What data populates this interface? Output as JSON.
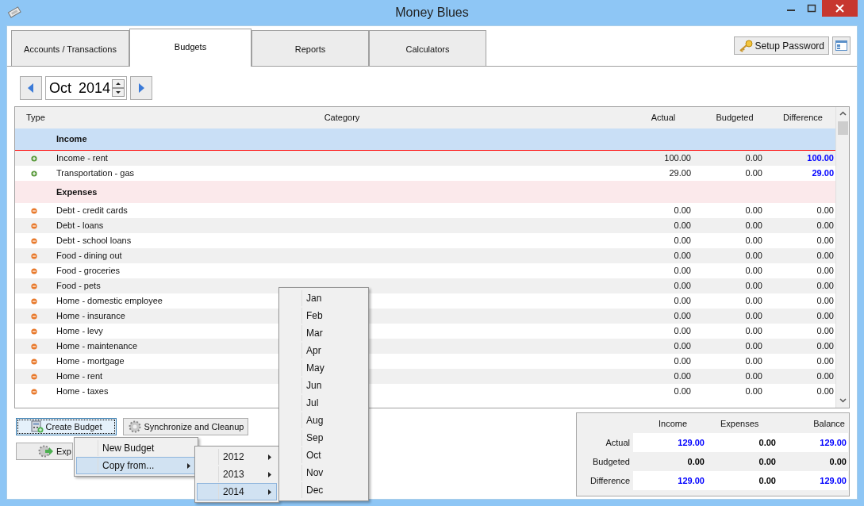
{
  "window": {
    "title": "Money Blues"
  },
  "tabs": [
    {
      "label": "Accounts / Transactions",
      "selected": false
    },
    {
      "label": "Budgets",
      "selected": true
    },
    {
      "label": "Reports",
      "selected": false
    },
    {
      "label": "Calculators",
      "selected": false
    }
  ],
  "setup_password": "Setup Password",
  "period": {
    "value": "Oct 2014"
  },
  "table": {
    "columns": [
      "Type",
      "Category",
      "Actual",
      "Budgeted",
      "Difference"
    ],
    "groups": [
      {
        "name": "Income",
        "kind": "income",
        "rows": [
          {
            "category": "Income - rent",
            "actual": "100.00",
            "budgeted": "0.00",
            "difference": "100.00",
            "highlighted": true
          },
          {
            "category": "Transportation - gas",
            "actual": "29.00",
            "budgeted": "0.00",
            "difference": "29.00",
            "highlighted": true
          }
        ]
      },
      {
        "name": "Expenses",
        "kind": "expense",
        "rows": [
          {
            "category": "Debt - credit cards",
            "actual": "0.00",
            "budgeted": "0.00",
            "difference": "0.00",
            "highlighted": false
          },
          {
            "category": "Debt - loans",
            "actual": "0.00",
            "budgeted": "0.00",
            "difference": "0.00",
            "highlighted": false
          },
          {
            "category": "Debt - school loans",
            "actual": "0.00",
            "budgeted": "0.00",
            "difference": "0.00",
            "highlighted": false
          },
          {
            "category": "Food - dining out",
            "actual": "0.00",
            "budgeted": "0.00",
            "difference": "0.00",
            "highlighted": false
          },
          {
            "category": "Food - groceries",
            "actual": "0.00",
            "budgeted": "0.00",
            "difference": "0.00",
            "highlighted": false
          },
          {
            "category": "Food - pets",
            "actual": "0.00",
            "budgeted": "0.00",
            "difference": "0.00",
            "highlighted": false
          },
          {
            "category": "Home - domestic employee",
            "actual": "0.00",
            "budgeted": "0.00",
            "difference": "0.00",
            "highlighted": false
          },
          {
            "category": "Home - insurance",
            "actual": "0.00",
            "budgeted": "0.00",
            "difference": "0.00",
            "highlighted": false
          },
          {
            "category": "Home - levy",
            "actual": "0.00",
            "budgeted": "0.00",
            "difference": "0.00",
            "highlighted": false
          },
          {
            "category": "Home - maintenance",
            "actual": "0.00",
            "budgeted": "0.00",
            "difference": "0.00",
            "highlighted": false
          },
          {
            "category": "Home - mortgage",
            "actual": "0.00",
            "budgeted": "0.00",
            "difference": "0.00",
            "highlighted": false
          },
          {
            "category": "Home - rent",
            "actual": "0.00",
            "budgeted": "0.00",
            "difference": "0.00",
            "highlighted": false
          },
          {
            "category": "Home - taxes",
            "actual": "0.00",
            "budgeted": "0.00",
            "difference": "0.00",
            "highlighted": false
          }
        ]
      }
    ]
  },
  "buttons": [
    {
      "label": "Create Budget",
      "kind": "create",
      "focused": true
    },
    {
      "label": "Synchronize and Cleanup",
      "kind": "sync",
      "focused": false
    },
    {
      "label": "Exp",
      "kind": "export",
      "focused": false
    }
  ],
  "context_menu": [
    {
      "label": "New Budget",
      "selected": false,
      "submenu": false
    },
    {
      "label": "Copy from...",
      "selected": true,
      "submenu": true
    }
  ],
  "year_menu": [
    {
      "label": "2012",
      "selected": false
    },
    {
      "label": "2013",
      "selected": false
    },
    {
      "label": "2014",
      "selected": true
    }
  ],
  "month_menu": [
    "Jan",
    "Feb",
    "Mar",
    "Apr",
    "May",
    "Jun",
    "Jul",
    "Aug",
    "Sep",
    "Oct",
    "Nov",
    "Dec"
  ],
  "summary": {
    "columns": [
      "Income",
      "Expenses",
      "Balance"
    ],
    "rows": [
      {
        "label": "Actual",
        "cells": [
          {
            "value": "129.00",
            "highlighted": true
          },
          {
            "value": "0.00",
            "highlighted": false
          },
          {
            "value": "129.00",
            "highlighted": true
          }
        ]
      },
      {
        "label": "Budgeted",
        "cells": [
          {
            "value": "0.00",
            "highlighted": false
          },
          {
            "value": "0.00",
            "highlighted": false
          },
          {
            "value": "0.00",
            "highlighted": false
          }
        ]
      },
      {
        "label": "Difference",
        "cells": [
          {
            "value": "129.00",
            "highlighted": true
          },
          {
            "value": "0.00",
            "highlighted": false
          },
          {
            "value": "129.00",
            "highlighted": true
          }
        ]
      }
    ]
  }
}
